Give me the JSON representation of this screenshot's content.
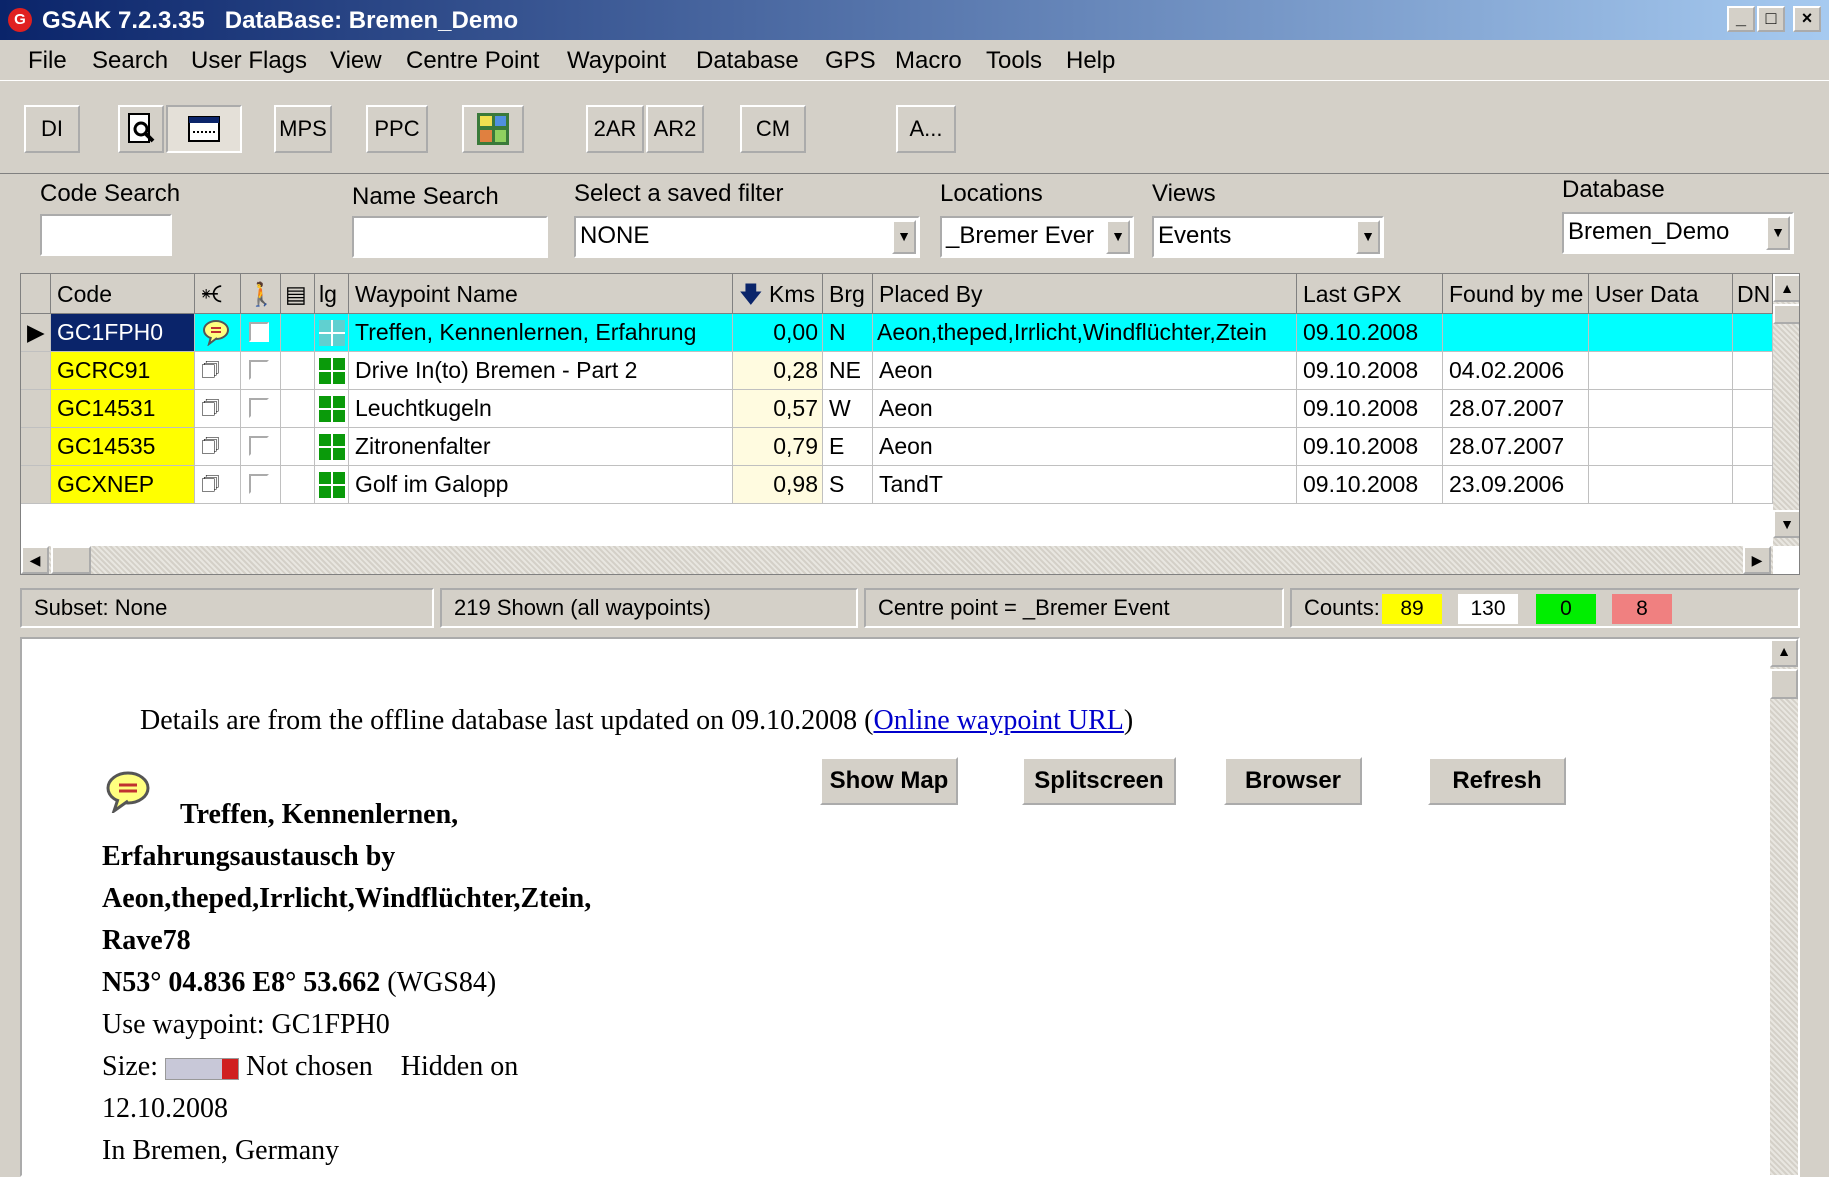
{
  "window": {
    "title": "GSAK 7.2.3.35   DataBase: Bremen_Demo",
    "controls": [
      "_",
      "□",
      "×"
    ]
  },
  "menu": [
    "File",
    "Search",
    "User Flags",
    "View",
    "Centre Point",
    "Waypoint",
    "Database",
    "GPS",
    "Macro",
    "Tools",
    "Help"
  ],
  "toolbar": {
    "buttons": [
      "DI",
      "MPS",
      "PPC",
      "2AR",
      "AR2",
      "CM",
      "A..."
    ]
  },
  "filters": {
    "code_search_label": "Code Search",
    "code_search_value": "",
    "name_search_label": "Name Search",
    "name_search_value": "",
    "saved_filter_label": "Select a saved filter",
    "saved_filter_value": "NONE",
    "locations_label": "Locations",
    "locations_value": "_Bremer Ever",
    "views_label": "Views",
    "views_value": "Events",
    "database_label": "Database",
    "database_value": "Bremen_Demo"
  },
  "grid": {
    "columns": {
      "code": "Code",
      "lg": "lg",
      "name": "Waypoint Name",
      "kms": "Kms",
      "brg": "Brg",
      "placed_by": "Placed By",
      "last_gpx": "Last GPX",
      "found": "Found by me",
      "user_data": "User Data",
      "dnf": "DN"
    },
    "rows": [
      {
        "code": "GC1FPH0",
        "name": "Treffen, Kennenlernen, Erfahrung",
        "kms": "0,00",
        "brg": "N",
        "placed_by": "Aeon,theped,Irrlicht,Windflüchter,Ztein",
        "last_gpx": "09.10.2008",
        "found": ""
      },
      {
        "code": "GCRC91",
        "name": "Drive In(to) Bremen - Part 2",
        "kms": "0,28",
        "brg": "NE",
        "placed_by": "Aeon",
        "last_gpx": "09.10.2008",
        "found": "04.02.2006"
      },
      {
        "code": "GC14531",
        "name": "Leuchtkugeln",
        "kms": "0,57",
        "brg": "W",
        "placed_by": "Aeon",
        "last_gpx": "09.10.2008",
        "found": "28.07.2007"
      },
      {
        "code": "GC14535",
        "name": "Zitronenfalter",
        "kms": "0,79",
        "brg": "E",
        "placed_by": "Aeon",
        "last_gpx": "09.10.2008",
        "found": "28.07.2007"
      },
      {
        "code": "GCXNEP",
        "name": "Golf im Galopp",
        "kms": "0,98",
        "brg": "S",
        "placed_by": "TandT",
        "last_gpx": "09.10.2008",
        "found": "23.09.2006"
      }
    ]
  },
  "status": {
    "subset": "Subset: None",
    "shown": "219 Shown (all waypoints)",
    "centre": "Centre point = _Bremer Event",
    "counts_label": "Counts:",
    "counts": [
      "89",
      "130",
      "0",
      "8"
    ],
    "count_colors": [
      "#ffff00",
      "#ffffff",
      "#00ee00",
      "#f08080"
    ]
  },
  "detail": {
    "info_prefix": "Details are from the offline database last updated on 09.10.2008 (",
    "info_link": "Online waypoint URL",
    "info_suffix": ")",
    "buttons": [
      "Show Map",
      "Splitscreen",
      "Browser",
      "Refresh"
    ],
    "title_lines": [
      "Treffen, Kennenlernen,",
      "Erfahrungsaustausch by",
      "Aeon,theped,Irrlicht,Windflüchter,Ztein,",
      "Rave78"
    ],
    "coords_bold": "N53° 04.836  E8° 53.662",
    "coords_datum": "(WGS84)",
    "use_waypoint": "Use waypoint: GC1FPH0",
    "size_label": "Size:",
    "size_value": "Not chosen",
    "hidden_label": "Hidden on",
    "hidden_date": "12.10.2008",
    "location": "In Bremen, Germany"
  }
}
